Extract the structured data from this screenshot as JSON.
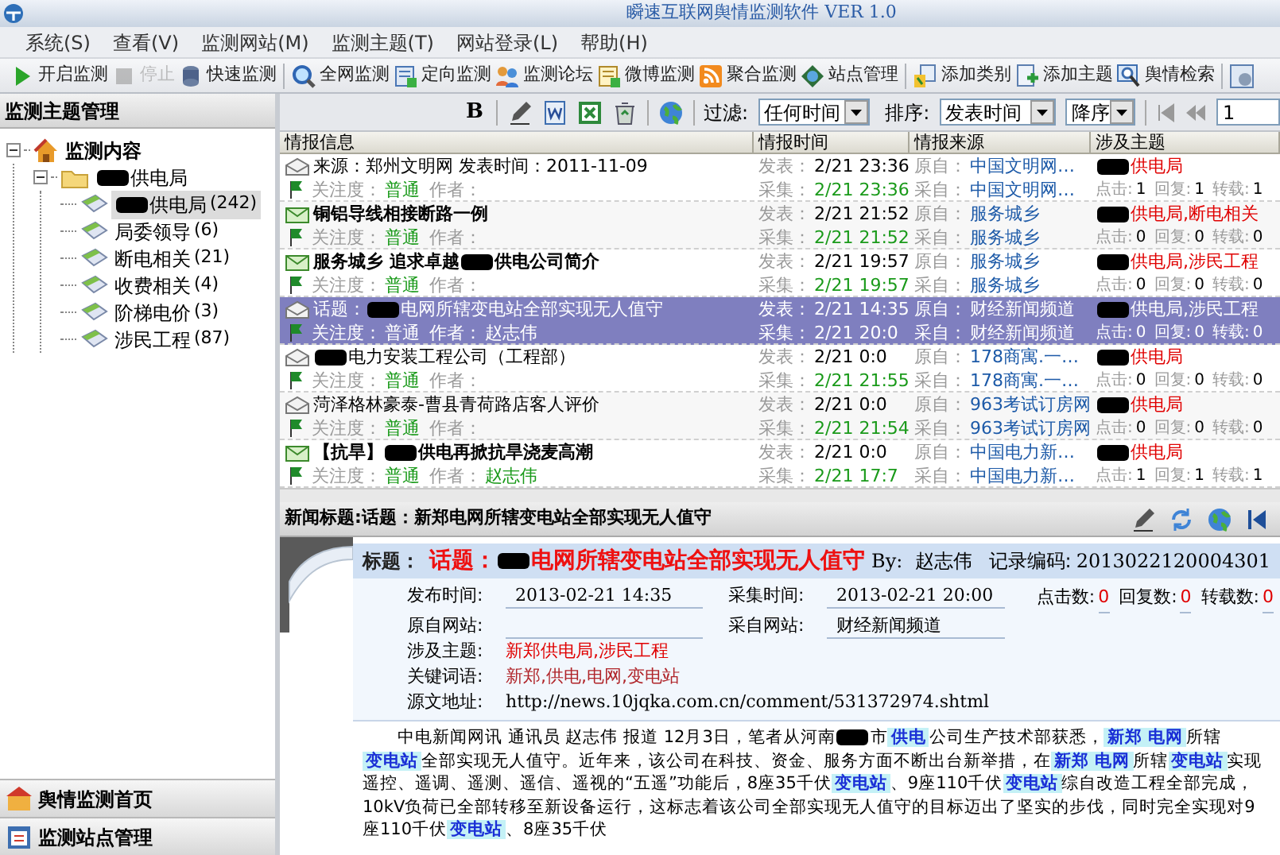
{
  "window": {
    "title": "瞬速互联网舆情监测软件 VER 1.0"
  },
  "menu": [
    "系统(S)",
    "查看(V)",
    "监测网站(M)",
    "监测主题(T)",
    "网站登录(L)",
    "帮助(H)"
  ],
  "toolbar": [
    {
      "kind": "button",
      "label": "开启监测",
      "disabled": false
    },
    {
      "kind": "button",
      "label": "停止",
      "disabled": true
    },
    {
      "kind": "button",
      "label": "快速监测",
      "disabled": false
    },
    {
      "kind": "separator"
    },
    {
      "kind": "button",
      "label": "全网监测",
      "disabled": false
    },
    {
      "kind": "button",
      "label": "定向监测",
      "disabled": false
    },
    {
      "kind": "button",
      "label": "监测论坛",
      "disabled": false
    },
    {
      "kind": "button",
      "label": "微博监测",
      "disabled": false
    },
    {
      "kind": "button",
      "label": "聚合监测",
      "disabled": false
    },
    {
      "kind": "button",
      "label": "站点管理",
      "disabled": false
    },
    {
      "kind": "separator"
    },
    {
      "kind": "button",
      "label": "添加类别",
      "disabled": false
    },
    {
      "kind": "button",
      "label": "添加主题",
      "disabled": false
    },
    {
      "kind": "button",
      "label": "舆情检索",
      "disabled": false
    },
    {
      "kind": "separator"
    },
    {
      "kind": "icon_button",
      "disabled": false
    }
  ],
  "sidebar": {
    "title": "监测主题管理",
    "tree": [
      {
        "label": [
          {
            "kind": "text",
            "text": "监测内容"
          }
        ],
        "selected": false,
        "expanded": true,
        "children": [
          {
            "label": [
              {
                "kind": "redacted"
              },
              {
                "kind": "text",
                "text": "供电局"
              }
            ],
            "selected": false,
            "expanded": true,
            "children": [
              {
                "label": [
                  {
                    "kind": "redacted"
                  },
                  {
                    "kind": "text",
                    "text": "供电局"
                  }
                ],
                "count": "(242)",
                "selected": true
              },
              {
                "label": [
                  {
                    "kind": "text",
                    "text": "局委领导"
                  }
                ],
                "count": "(6)",
                "selected": false
              },
              {
                "label": [
                  {
                    "kind": "text",
                    "text": "断电相关"
                  }
                ],
                "count": "(21)",
                "selected": false
              },
              {
                "label": [
                  {
                    "kind": "text",
                    "text": "收费相关"
                  }
                ],
                "count": "(4)",
                "selected": false
              },
              {
                "label": [
                  {
                    "kind": "text",
                    "text": "阶梯电价"
                  }
                ],
                "count": "(3)",
                "selected": false
              },
              {
                "label": [
                  {
                    "kind": "text",
                    "text": "涉民工程"
                  }
                ],
                "count": "(87)",
                "selected": false
              }
            ]
          }
        ]
      }
    ],
    "nav": [
      {
        "label": "舆情监测首页"
      },
      {
        "label": "监测站点管理"
      }
    ]
  },
  "list_toolbar": {
    "bold_button": "B",
    "filter_label": "过滤:",
    "filter_value": "任何时间",
    "sort_label": "排序:",
    "sort_value": "发表时间",
    "order_value": "降序",
    "page": "1"
  },
  "table": {
    "columns": [
      "情报信息",
      "情报时间",
      "情报来源",
      "涉及主题"
    ],
    "rows": [
      {
        "read": true,
        "selected": false,
        "title": [
          {
            "kind": "text",
            "text": "来源：郑州文明网 发表时间：2011-11-09"
          }
        ],
        "interest_label": "关注度：",
        "interest": "普通",
        "author_label": "作者：",
        "published_label": "发表：",
        "published": "2/21 23:36",
        "collected_label": "采集：",
        "collected": "2/21 23:36",
        "origin_label": "原自：",
        "origin": "中国文明网…",
        "source_label": "采自：",
        "source": "中国文明网…",
        "topics": [
          {
            "kind": "redacted"
          },
          {
            "kind": "text",
            "text": "供电局"
          }
        ],
        "clicks_label": "点击:",
        "clicks": "1",
        "replies_label": "回复:",
        "replies": "1",
        "reposts_label": "转载:",
        "reposts": "1"
      },
      {
        "read": false,
        "selected": false,
        "title": [
          {
            "kind": "text",
            "text": "铜铝导线相接断路一例"
          }
        ],
        "interest_label": "关注度：",
        "interest": "普通",
        "author_label": "作者：",
        "published_label": "发表：",
        "published": "2/21 21:52",
        "collected_label": "采集：",
        "collected": "2/21 21:52",
        "origin_label": "原自：",
        "origin": "服务城乡",
        "source_label": "采自：",
        "source": "服务城乡",
        "topics": [
          {
            "kind": "redacted"
          },
          {
            "kind": "text",
            "text": "供电局,断电相关"
          }
        ],
        "clicks_label": "点击:",
        "clicks": "0",
        "replies_label": "回复:",
        "replies": "0",
        "reposts_label": "转载:",
        "reposts": "0"
      },
      {
        "read": false,
        "selected": false,
        "title": [
          {
            "kind": "text",
            "text": "服务城乡 追求卓越 "
          },
          {
            "kind": "redacted"
          },
          {
            "kind": "text",
            "text": "供电公司简介"
          }
        ],
        "interest_label": "关注度：",
        "interest": "普通",
        "author_label": "作者：",
        "published_label": "发表：",
        "published": "2/21 19:57",
        "collected_label": "采集：",
        "collected": "2/21 19:57",
        "origin_label": "原自：",
        "origin": "服务城乡",
        "source_label": "采自：",
        "source": "服务城乡",
        "topics": [
          {
            "kind": "redacted"
          },
          {
            "kind": "text",
            "text": "供电局,涉民工程"
          }
        ],
        "clicks_label": "点击:",
        "clicks": "0",
        "replies_label": "回复:",
        "replies": "0",
        "reposts_label": "转载:",
        "reposts": "0"
      },
      {
        "read": true,
        "selected": true,
        "title": [
          {
            "kind": "text",
            "text": "话题："
          },
          {
            "kind": "redacted"
          },
          {
            "kind": "text",
            "text": "电网所辖变电站全部实现无人值守"
          }
        ],
        "interest_label": "关注度：",
        "interest": "普通",
        "author_label": "作者：",
        "author": "赵志伟",
        "published_label": "发表：",
        "published": "2/21 14:35",
        "collected_label": "采集：",
        "collected": "2/21 20:0",
        "origin_label": "原自：",
        "origin": "财经新闻频道",
        "source_label": "采自：",
        "source": "财经新闻频道",
        "topics": [
          {
            "kind": "redacted"
          },
          {
            "kind": "text",
            "text": "供电局,涉民工程"
          }
        ],
        "clicks_label": "点击:",
        "clicks": "0",
        "replies_label": "回复:",
        "replies": "0",
        "reposts_label": "转载:",
        "reposts": "0"
      },
      {
        "read": true,
        "selected": false,
        "title": [
          {
            "kind": "redacted"
          },
          {
            "kind": "text",
            "text": "电力安装工程公司（工程部）"
          }
        ],
        "interest_label": "关注度：",
        "interest": "普通",
        "author_label": "作者：",
        "published_label": "发表：",
        "published": "2/21 0:0",
        "collected_label": "采集：",
        "collected": "2/21 21:55",
        "origin_label": "原自：",
        "origin": "178商寓.一…",
        "source_label": "采自：",
        "source": "178商寓.一…",
        "topics": [
          {
            "kind": "redacted"
          },
          {
            "kind": "text",
            "text": "供电局"
          }
        ],
        "clicks_label": "点击:",
        "clicks": "0",
        "replies_label": "回复:",
        "replies": "0",
        "reposts_label": "转载:",
        "reposts": "0"
      },
      {
        "read": true,
        "selected": false,
        "title": [
          {
            "kind": "text",
            "text": "菏泽格林豪泰-曹县青荷路店客人评价"
          }
        ],
        "interest_label": "关注度：",
        "interest": "普通",
        "author_label": "作者：",
        "published_label": "发表：",
        "published": "2/21 0:0",
        "collected_label": "采集：",
        "collected": "2/21 21:54",
        "origin_label": "原自：",
        "origin": "963考试订房网",
        "source_label": "采自：",
        "source": "963考试订房网",
        "topics": [
          {
            "kind": "redacted"
          },
          {
            "kind": "text",
            "text": "供电局"
          }
        ],
        "clicks_label": "点击:",
        "clicks": "0",
        "replies_label": "回复:",
        "replies": "0",
        "reposts_label": "转载:",
        "reposts": "0"
      },
      {
        "read": false,
        "selected": false,
        "title": [
          {
            "kind": "text",
            "text": "【抗旱】"
          },
          {
            "kind": "redacted"
          },
          {
            "kind": "text",
            "text": "供电再掀抗旱浇麦高潮"
          }
        ],
        "interest_label": "关注度：",
        "interest": "普通",
        "author_label": "作者：",
        "author": "赵志伟",
        "published_label": "发表：",
        "published": "2/21 0:0",
        "collected_label": "采集：",
        "collected": "2/21 17:7",
        "origin_label": "原自：",
        "origin": "中国电力新…",
        "source_label": "采自：",
        "source": "中国电力新…",
        "topics": [
          {
            "kind": "redacted"
          },
          {
            "kind": "text",
            "text": "供电局"
          }
        ],
        "clicks_label": "点击:",
        "clicks": "1",
        "replies_label": "回复:",
        "replies": "1",
        "reposts_label": "转载:",
        "reposts": "1"
      }
    ]
  },
  "detail": {
    "header": "新闻标题:话题：新郑电网所辖变电站全部实现无人值守",
    "title_label": "标题：",
    "title": [
      {
        "kind": "text",
        "text": "话题："
      },
      {
        "kind": "redacted"
      },
      {
        "kind": "text",
        "text": "电网所辖变电站全部实现无人值守"
      }
    ],
    "by_label": "By:",
    "author": "赵志伟",
    "record_label": "记录编码:",
    "record": "2013022120004301",
    "meta": [
      {
        "label": "发布时间:",
        "value": "2013-02-21 14:35"
      },
      {
        "label": "采集时间:",
        "value": "2013-02-21 20:00"
      },
      {
        "label": "原自网站:"
      },
      {
        "label": "采自网站:",
        "value": "财经新闻频道"
      }
    ],
    "stats": [
      {
        "label": "点击数:",
        "value": "0"
      },
      {
        "label": "回复数:",
        "value": "0"
      },
      {
        "label": "转载数:",
        "value": "0"
      }
    ],
    "details": [
      {
        "kind": "topic",
        "label": "涉及主题:",
        "value": "新郑供电局,涉民工程"
      },
      {
        "kind": "keyword",
        "label": "关键词语:",
        "value": "新郑,供电,电网,变电站"
      },
      {
        "kind": "url",
        "label": "源文地址:",
        "value": "http://news.10jqka.com.cn/comment/531372974.shtml"
      }
    ],
    "body": [
      {
        "kind": "text",
        "text": "中电新闻网讯 通讯员 赵志伟 报道 12月3日，笔者从河南"
      },
      {
        "kind": "redacted"
      },
      {
        "kind": "text",
        "text": "市"
      },
      {
        "kind": "keyword",
        "text": "供电"
      },
      {
        "kind": "text",
        "text": "公司生产技术部获悉，"
      },
      {
        "kind": "keyword",
        "text": "新郑 电网"
      },
      {
        "kind": "text",
        "text": "所辖"
      },
      {
        "kind": "keyword",
        "text": "变电站"
      },
      {
        "kind": "text",
        "text": "全部实现无人值守。近年来，该公司在科技、资金、服务方面不断出台新举措，在"
      },
      {
        "kind": "keyword",
        "text": "新郑 电网"
      },
      {
        "kind": "text",
        "text": "所辖"
      },
      {
        "kind": "keyword",
        "text": "变电站"
      },
      {
        "kind": "text",
        "text": "实现遥控、遥调、遥测、遥信、遥视的“五遥”功能后，8座35千伏"
      },
      {
        "kind": "keyword",
        "text": "变电站"
      },
      {
        "kind": "text",
        "text": "、9座110千伏"
      },
      {
        "kind": "keyword",
        "text": "变电站"
      },
      {
        "kind": "text",
        "text": "综自改造工程全部完成，10kV负荷已全部转移至新设备运行，这标志着该公司全部实现无人值守的目标迈出了坚实的步伐，同时完全实现对9座110千伏"
      },
      {
        "kind": "keyword",
        "text": "变电站"
      },
      {
        "kind": "text",
        "text": "、8座35千伏"
      }
    ]
  }
}
